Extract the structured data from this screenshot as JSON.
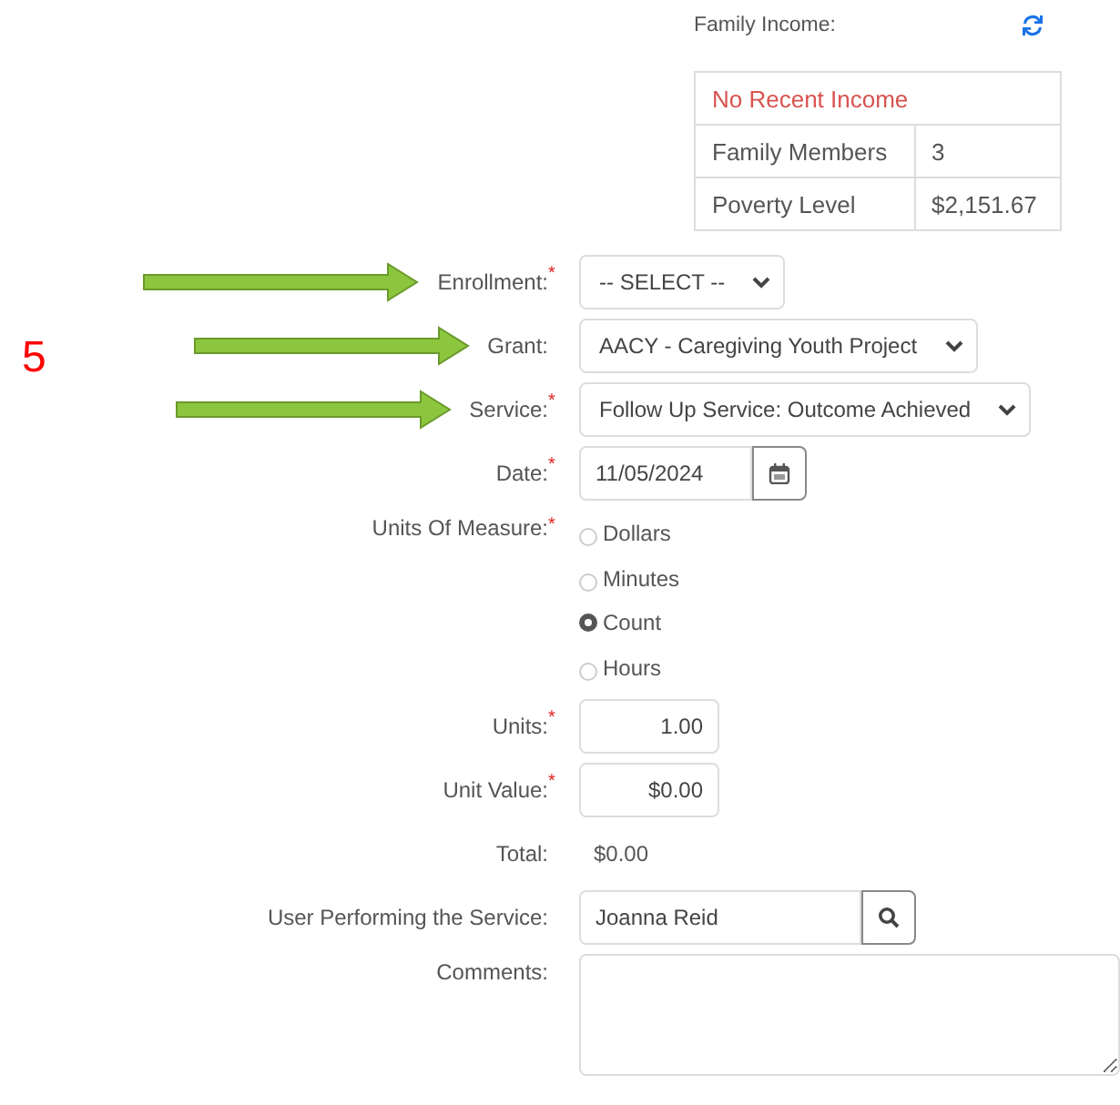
{
  "family_income": {
    "label": "Family Income:",
    "message": "No Recent Income",
    "rows": [
      {
        "label": "Family Members",
        "value": "3"
      },
      {
        "label": "Poverty Level",
        "value": "$2,151.67"
      }
    ]
  },
  "step_number": "5",
  "fields": [
    {
      "kind": "select",
      "label": "Enrollment:",
      "required_mark": "*",
      "arrow": true,
      "value": "-- SELECT --"
    },
    {
      "kind": "select",
      "label": "Grant:",
      "arrow": true,
      "value": "AACY - Caregiving Youth Project"
    },
    {
      "kind": "select",
      "label": "Service:",
      "required_mark": "*",
      "arrow": true,
      "value": "Follow Up Service: Outcome Achieved"
    },
    {
      "kind": "date",
      "label": "Date:",
      "required_mark": "*",
      "value": "11/05/2024"
    },
    {
      "kind": "radio",
      "label": "Units Of Measure:",
      "required_mark": "*",
      "options": [
        {
          "label": "Dollars",
          "selected": false
        },
        {
          "label": "Minutes",
          "selected": false
        },
        {
          "label": "Count",
          "selected": true
        },
        {
          "label": "Hours",
          "selected": false
        }
      ]
    },
    {
      "kind": "number",
      "label": "Units:",
      "required_mark": "*",
      "value": "1.00"
    },
    {
      "kind": "number",
      "label": "Unit Value:",
      "required_mark": "*",
      "value": "$0.00"
    },
    {
      "kind": "static",
      "label": "Total:",
      "value": "$0.00"
    },
    {
      "kind": "lookup",
      "label": "User Performing the Service:",
      "value": "Joanna Reid"
    },
    {
      "kind": "textarea",
      "label": "Comments:"
    }
  ]
}
